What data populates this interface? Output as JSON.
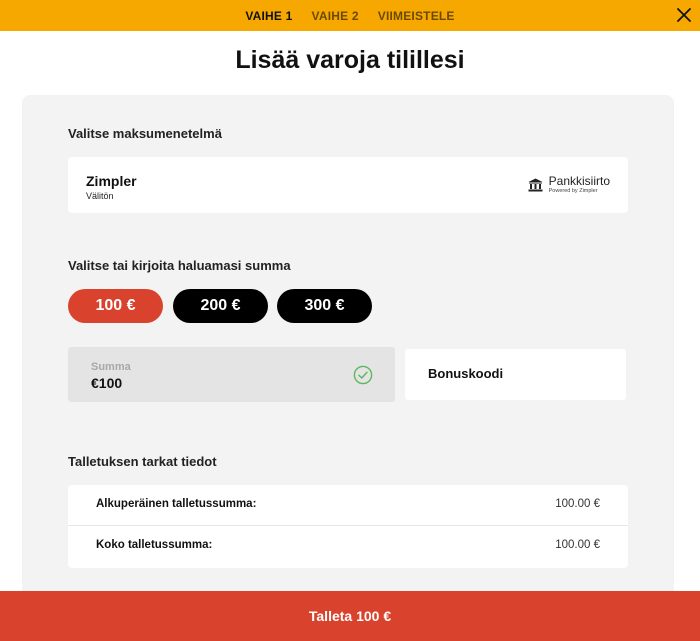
{
  "steps": [
    {
      "label": "VAIHE 1",
      "active": true
    },
    {
      "label": "VAIHE 2",
      "active": false
    },
    {
      "label": "VIIMEISTELE",
      "active": false
    }
  ],
  "title": "Lisää varoja tilillesi",
  "payment_section": {
    "label": "Valitse maksumenetelmä",
    "method": {
      "name": "Zimpler",
      "subtitle": "Välitön",
      "brand_name": "Pankkisiirto",
      "brand_powered": "Powered by Zimpler",
      "icon": "bank-icon"
    }
  },
  "amount_section": {
    "label": "Valitse tai kirjoita haluamasi summa",
    "options": [
      "100 €",
      "200 €",
      "300 €"
    ],
    "selected_index": 0,
    "sum_placeholder": "Summa",
    "sum_value": "€100",
    "bonus_label": "Bonuskoodi"
  },
  "details_section": {
    "label": "Talletuksen tarkat tiedot",
    "rows": [
      {
        "label": "Alkuperäinen talletussumma:",
        "value": "100.00 €"
      },
      {
        "label": "Koko talletussumma:",
        "value": "100.00 €"
      }
    ]
  },
  "submit_label": "Talleta 100 €",
  "colors": {
    "topbar": "#f6a800",
    "accent": "#d9432d",
    "panel": "#f3f3f3",
    "check": "#5cb85c"
  }
}
